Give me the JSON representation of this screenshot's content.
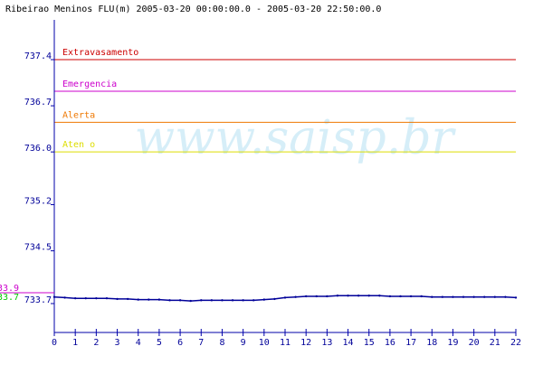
{
  "chart_data": {
    "type": "line",
    "title": "Ribeirao Meninos FLU(m) 2005-03-20 00:00:00.0 - 2005-03-20 22:50:00.0",
    "watermark": "www.saisp.br",
    "xlabel": "",
    "ylabel": "",
    "x_ticks": [
      0,
      1,
      2,
      3,
      4,
      5,
      6,
      7,
      8,
      9,
      10,
      11,
      12,
      13,
      14,
      15,
      16,
      17,
      18,
      19,
      20,
      21,
      22
    ],
    "xlim": [
      0,
      22
    ],
    "y_ticks": [
      737.4,
      736.7,
      736.0,
      735.2,
      734.5,
      733.7
    ],
    "ylim": [
      733.6,
      737.6
    ],
    "thresholds": [
      {
        "label": "Extravasamento",
        "value": 737.4,
        "color": "#cc0000"
      },
      {
        "label": "Emergencia",
        "value": 736.92,
        "color": "#cc00cc"
      },
      {
        "label": "Alerta",
        "value": 736.45,
        "color": "#ee7700"
      },
      {
        "label": "Aten  o",
        "value": 736.0,
        "color": "#dddd00"
      }
    ],
    "left_markers": [
      {
        "label": "33.9",
        "color": "#cc00cc"
      },
      {
        "label": "33.7",
        "color": "#00cc00"
      }
    ],
    "series": [
      {
        "color": "#000099",
        "x": [
          0,
          0.5,
          1,
          1.5,
          2,
          2.5,
          3,
          3.5,
          4,
          4.5,
          5,
          5.5,
          6,
          6.5,
          7,
          7.5,
          8,
          8.5,
          9,
          9.5,
          10,
          10.5,
          11,
          11.5,
          12,
          12.5,
          13,
          13.5,
          14,
          14.5,
          15,
          15.5,
          16,
          16.5,
          17,
          17.5,
          18,
          18.5,
          19,
          19.5,
          20,
          20.5,
          21,
          21.5,
          22
        ],
        "y": [
          733.8,
          733.79,
          733.78,
          733.78,
          733.78,
          733.78,
          733.77,
          733.77,
          733.76,
          733.76,
          733.76,
          733.75,
          733.75,
          733.74,
          733.75,
          733.75,
          733.75,
          733.75,
          733.75,
          733.75,
          733.76,
          733.77,
          733.79,
          733.8,
          733.81,
          733.81,
          733.81,
          733.82,
          733.82,
          733.82,
          733.82,
          733.82,
          733.81,
          733.81,
          733.81,
          733.81,
          733.8,
          733.8,
          733.8,
          733.8,
          733.8,
          733.8,
          733.8,
          733.8,
          733.79
        ]
      }
    ]
  }
}
